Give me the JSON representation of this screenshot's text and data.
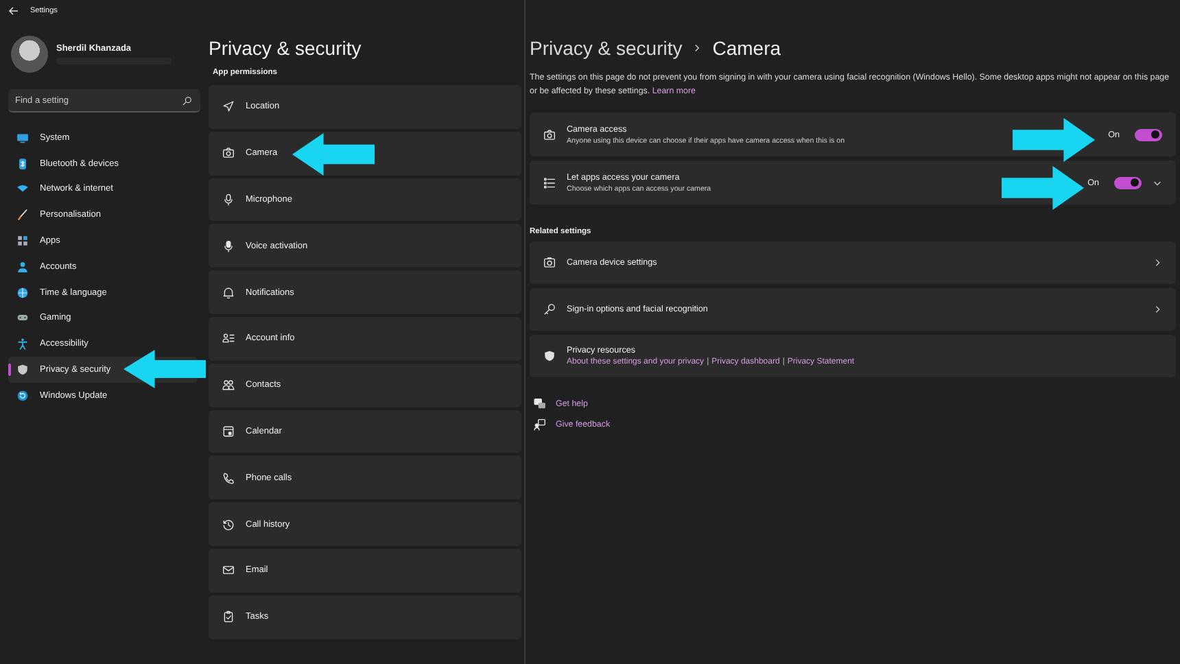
{
  "window": {
    "title": "Settings"
  },
  "user": {
    "name": "Sherdil Khanzada"
  },
  "search": {
    "placeholder": "Find a setting"
  },
  "nav": [
    {
      "label": "System",
      "selected": false
    },
    {
      "label": "Bluetooth & devices",
      "selected": false
    },
    {
      "label": "Network & internet",
      "selected": false
    },
    {
      "label": "Personalisation",
      "selected": false
    },
    {
      "label": "Apps",
      "selected": false
    },
    {
      "label": "Accounts",
      "selected": false
    },
    {
      "label": "Time & language",
      "selected": false
    },
    {
      "label": "Gaming",
      "selected": false
    },
    {
      "label": "Accessibility",
      "selected": false
    },
    {
      "label": "Privacy & security",
      "selected": true
    },
    {
      "label": "Windows Update",
      "selected": false
    }
  ],
  "permissions": {
    "title": "Privacy & security",
    "section": "App permissions",
    "items": [
      {
        "label": "Location"
      },
      {
        "label": "Camera"
      },
      {
        "label": "Microphone"
      },
      {
        "label": "Voice activation"
      },
      {
        "label": "Notifications"
      },
      {
        "label": "Account info"
      },
      {
        "label": "Contacts"
      },
      {
        "label": "Calendar"
      },
      {
        "label": "Phone calls"
      },
      {
        "label": "Call history"
      },
      {
        "label": "Email"
      },
      {
        "label": "Tasks"
      }
    ]
  },
  "camera": {
    "breadcrumb": {
      "parent": "Privacy & security",
      "current": "Camera"
    },
    "description": "The settings on this page do not prevent you from signing in with your camera using facial recognition (Windows Hello). Some desktop apps might not appear on this page or be affected by these settings.",
    "learn_more": "Learn more",
    "toggles": [
      {
        "title": "Camera access",
        "subtitle": "Anyone using this device can choose if their apps have camera access when this is on",
        "state": "On",
        "on": true,
        "expandable": false
      },
      {
        "title": "Let apps access your camera",
        "subtitle": "Choose which apps can access your camera",
        "state": "On",
        "on": true,
        "expandable": true
      }
    ],
    "related_title": "Related settings",
    "related": [
      {
        "label": "Camera device settings"
      },
      {
        "label": "Sign-in options and facial recognition"
      }
    ],
    "resources": {
      "title": "Privacy resources",
      "separator": "|",
      "links": [
        "About these settings and your privacy",
        "Privacy dashboard",
        "Privacy Statement"
      ]
    },
    "help": [
      {
        "label": "Get help"
      },
      {
        "label": "Give feedback"
      }
    ]
  }
}
